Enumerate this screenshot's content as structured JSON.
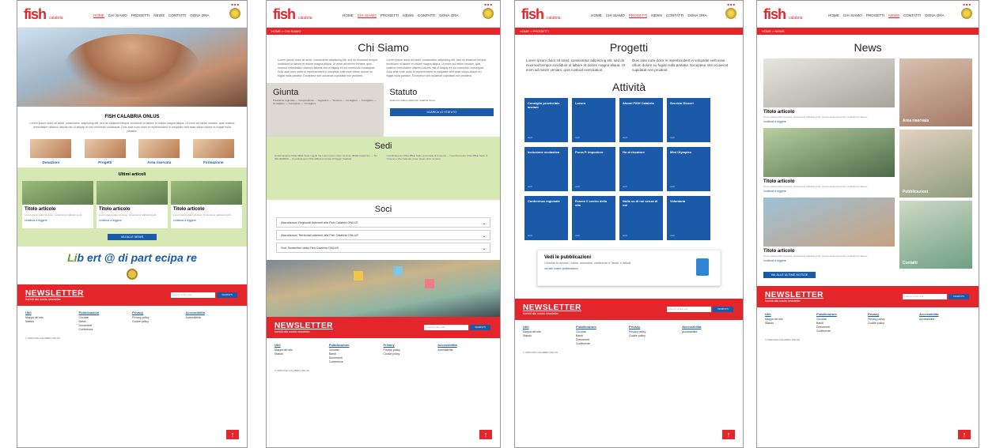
{
  "header": {
    "logo_main": "fish",
    "logo_sub": "calabria",
    "nav": [
      "HOME",
      "CHI SIAMO",
      "PROGETTI",
      "NEWS",
      "CONTATTI",
      "DONA ORA"
    ]
  },
  "home": {
    "title": "FISH CALABRIA ONLUS",
    "intro": "Lorem ipsum dolor sit amet, consectetur adipiscing elit, sed do eiusmod tempor incididunt ut labore et dolore magna aliqua. Ut enim ad minim veniam, quis nostrud exercitation ullamco laboris nisi ut aliquip ex ea commodo consequat. Duis aute irure dolor in reprehenderit in voluptate velit esse cillum dolore eu fugiat nulla pariatur.",
    "tiles": [
      "Donazioni",
      "Progetti",
      "Area riservata",
      "Formazione"
    ],
    "latest_title": "Ultimi articoli",
    "articles": [
      {
        "title": "Titolo articolo",
        "more": "continua a leggere"
      },
      {
        "title": "Titolo articolo",
        "more": "continua a leggere"
      },
      {
        "title": "Titolo articolo",
        "more": "continua a leggere"
      }
    ],
    "all_news": "VAI ALLE NEWS",
    "slogan_a": "Li",
    "slogan_b": "b ert @ di part ecipa re"
  },
  "chi_siamo": {
    "breadcrumb": "HOME > CHI SIAMO",
    "title": "Chi Siamo",
    "giunta_title": "Giunta",
    "statuto_title": "Statuto",
    "statuto_text": "Scarica lo statuto della Fish Calabria Onlus",
    "statuto_button": "SCARICA LO STATUTO",
    "sedi_title": "Sedi",
    "soci_title": "Soci",
    "soci_items": [
      "Associazioni Regionali Aderenti alla Fish Calabria ONLUS",
      "Associazioni Territoriali aderenti alla Fish Calabria ONLUS",
      "Soci Sostenitori della Fish Calabria ONLUS"
    ]
  },
  "progetti": {
    "breadcrumb": "HOME > PROGETTI",
    "title": "Progetti",
    "activity_title": "Attività",
    "boxes": [
      [
        "Consiglio provinciale anziani",
        "Lavoro",
        "Alunni FISH Calabria",
        "Servizio Disseri"
      ],
      [
        "Inclusione scolastica",
        "Forza P. Impostore",
        "Ho al riscatore",
        "Mini Olympics"
      ],
      [
        "Conferenza regionale",
        "Essere il centro della vita",
        "Nulla su di noi senza di noi",
        "Volontaria"
      ]
    ],
    "box_link": "vedi",
    "pub_title": "Vedi le pubblicazioni",
    "pub_text": "Consulta le circolari, i bandi, documenti, conferenze e Tavole, e articoli.",
    "pub_link": "vai alle nostre pubblicazioni"
  },
  "news": {
    "breadcrumb": "HOME > NEWS",
    "title": "News",
    "items": [
      "Titolo articolo",
      "Titolo articolo",
      "Titolo articolo"
    ],
    "more": "continua a leggere",
    "side": [
      "Area riservata",
      "Pubblicazioni",
      "Contatti"
    ],
    "all_button": "VAI ALLE ULTIME NOTIZIE"
  },
  "newsletter": {
    "title": "NEWSLETTER",
    "subtitle": "Iscriviti alla nostra newsletter",
    "placeholder": "inserisci la tua mail",
    "button": "ISCRIVITI"
  },
  "footer": {
    "cols": [
      {
        "head": "Utili",
        "items": [
          "Mappa del sito",
          "Statuto"
        ]
      },
      {
        "head": "Pubblicazioni",
        "items": [
          "Circolari",
          "Bandi",
          "Documenti",
          "Conferenze"
        ]
      },
      {
        "head": "Privacy",
        "items": [
          "Privacy policy",
          "Cookie policy"
        ]
      },
      {
        "head": "Accessibilità",
        "items": [
          "Accessibilità"
        ]
      }
    ],
    "copyright": "© 2020 FISH CALABRIA ONLUS"
  },
  "colors": {
    "brand_red": "#e3262b",
    "brand_blue": "#1b5aa8",
    "green_band": "#d6e8b4"
  }
}
